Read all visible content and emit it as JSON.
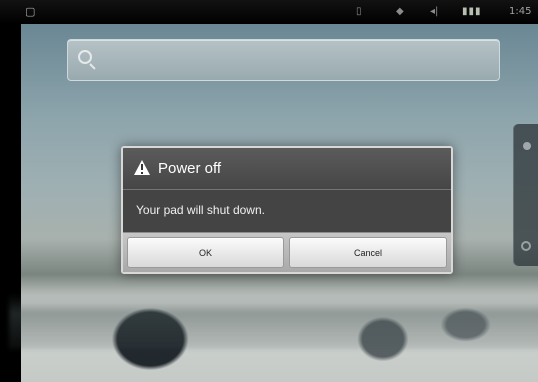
{
  "status_bar": {
    "icons": [
      "menu-icon",
      "storage-icon",
      "notification-icon",
      "wifi-icon",
      "signal-icon",
      "battery-icon"
    ],
    "time": "1:45"
  },
  "search": {
    "icon": "search-icon",
    "placeholder": ""
  },
  "dialog": {
    "title": "Power off",
    "message": "Your pad will shut down.",
    "buttons": {
      "ok": "OK",
      "cancel": "Cancel"
    },
    "icon": "warning-icon",
    "colors": {
      "header": "#5b5b5b",
      "body": "#444444",
      "button_bar": "#b8b8b8"
    }
  }
}
